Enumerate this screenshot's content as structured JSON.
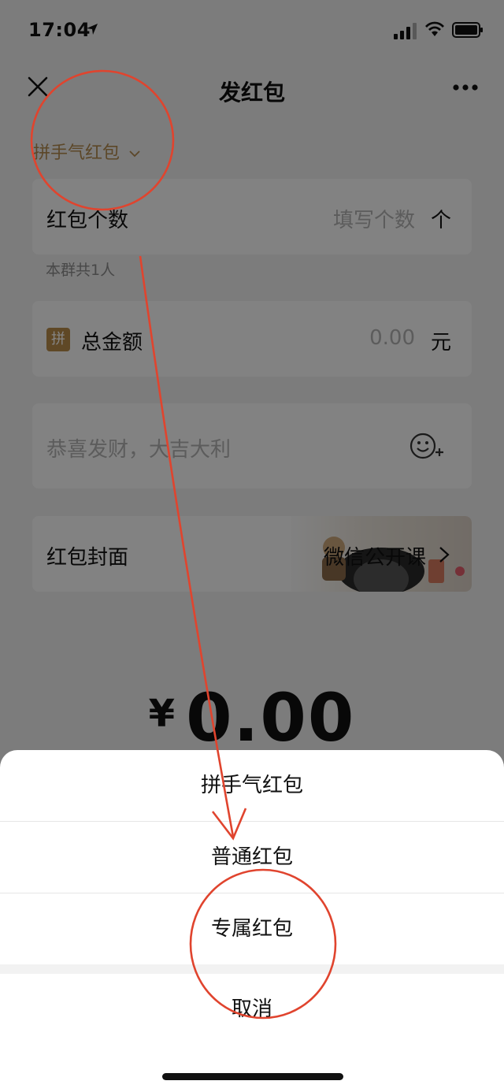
{
  "status_bar": {
    "time": "17:04"
  },
  "nav": {
    "title": "发红包"
  },
  "type_switch": {
    "label": "拼手气红包"
  },
  "count_row": {
    "label": "红包个数",
    "placeholder": "填写个数",
    "unit": "个"
  },
  "group_hint": "本群共1人",
  "amount_row": {
    "badge": "拼",
    "label": "总金额",
    "placeholder": "0.00",
    "unit": "元"
  },
  "greeting_row": {
    "placeholder": "恭喜发财，大吉大利"
  },
  "cover_row": {
    "label": "红包封面",
    "value": "微信公开课"
  },
  "total": {
    "symbol": "¥",
    "value": "0.00"
  },
  "sheet": {
    "options": [
      "拼手气红包",
      "普通红包",
      "专属红包"
    ],
    "cancel": "取消"
  },
  "colors": {
    "accent_gold": "#b0884e",
    "annotation_red": "#e0442e"
  }
}
